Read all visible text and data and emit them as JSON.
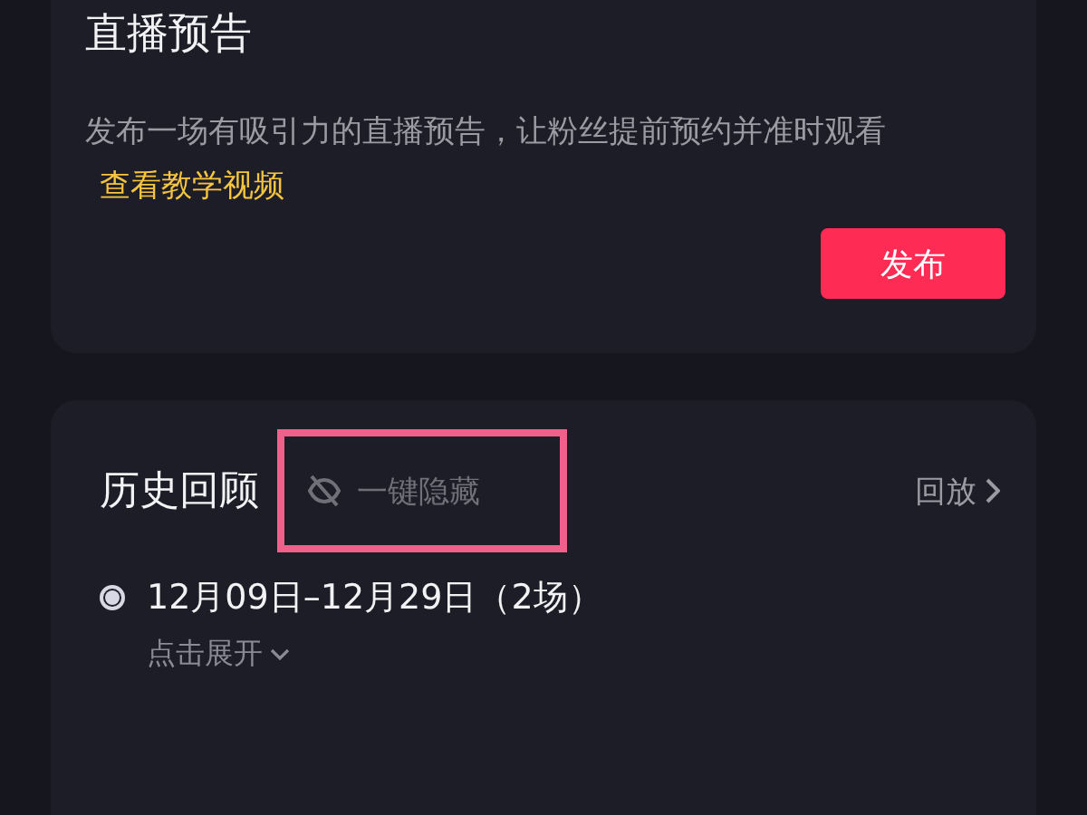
{
  "preview_card": {
    "title": "直播预告",
    "description": "发布一场有吸引力的直播预告，让粉丝提前预约并准时观看",
    "tutorial_link": "查看教学视频",
    "publish_button": "发布"
  },
  "history_card": {
    "title": "历史回顾",
    "hide_all": {
      "label": "一键隐藏",
      "highlighted": true
    },
    "replay_link": "回放",
    "sessions": [
      {
        "range": "12月09日–12月29日（2场）",
        "selected": true,
        "expand_label": "点击展开"
      }
    ]
  }
}
